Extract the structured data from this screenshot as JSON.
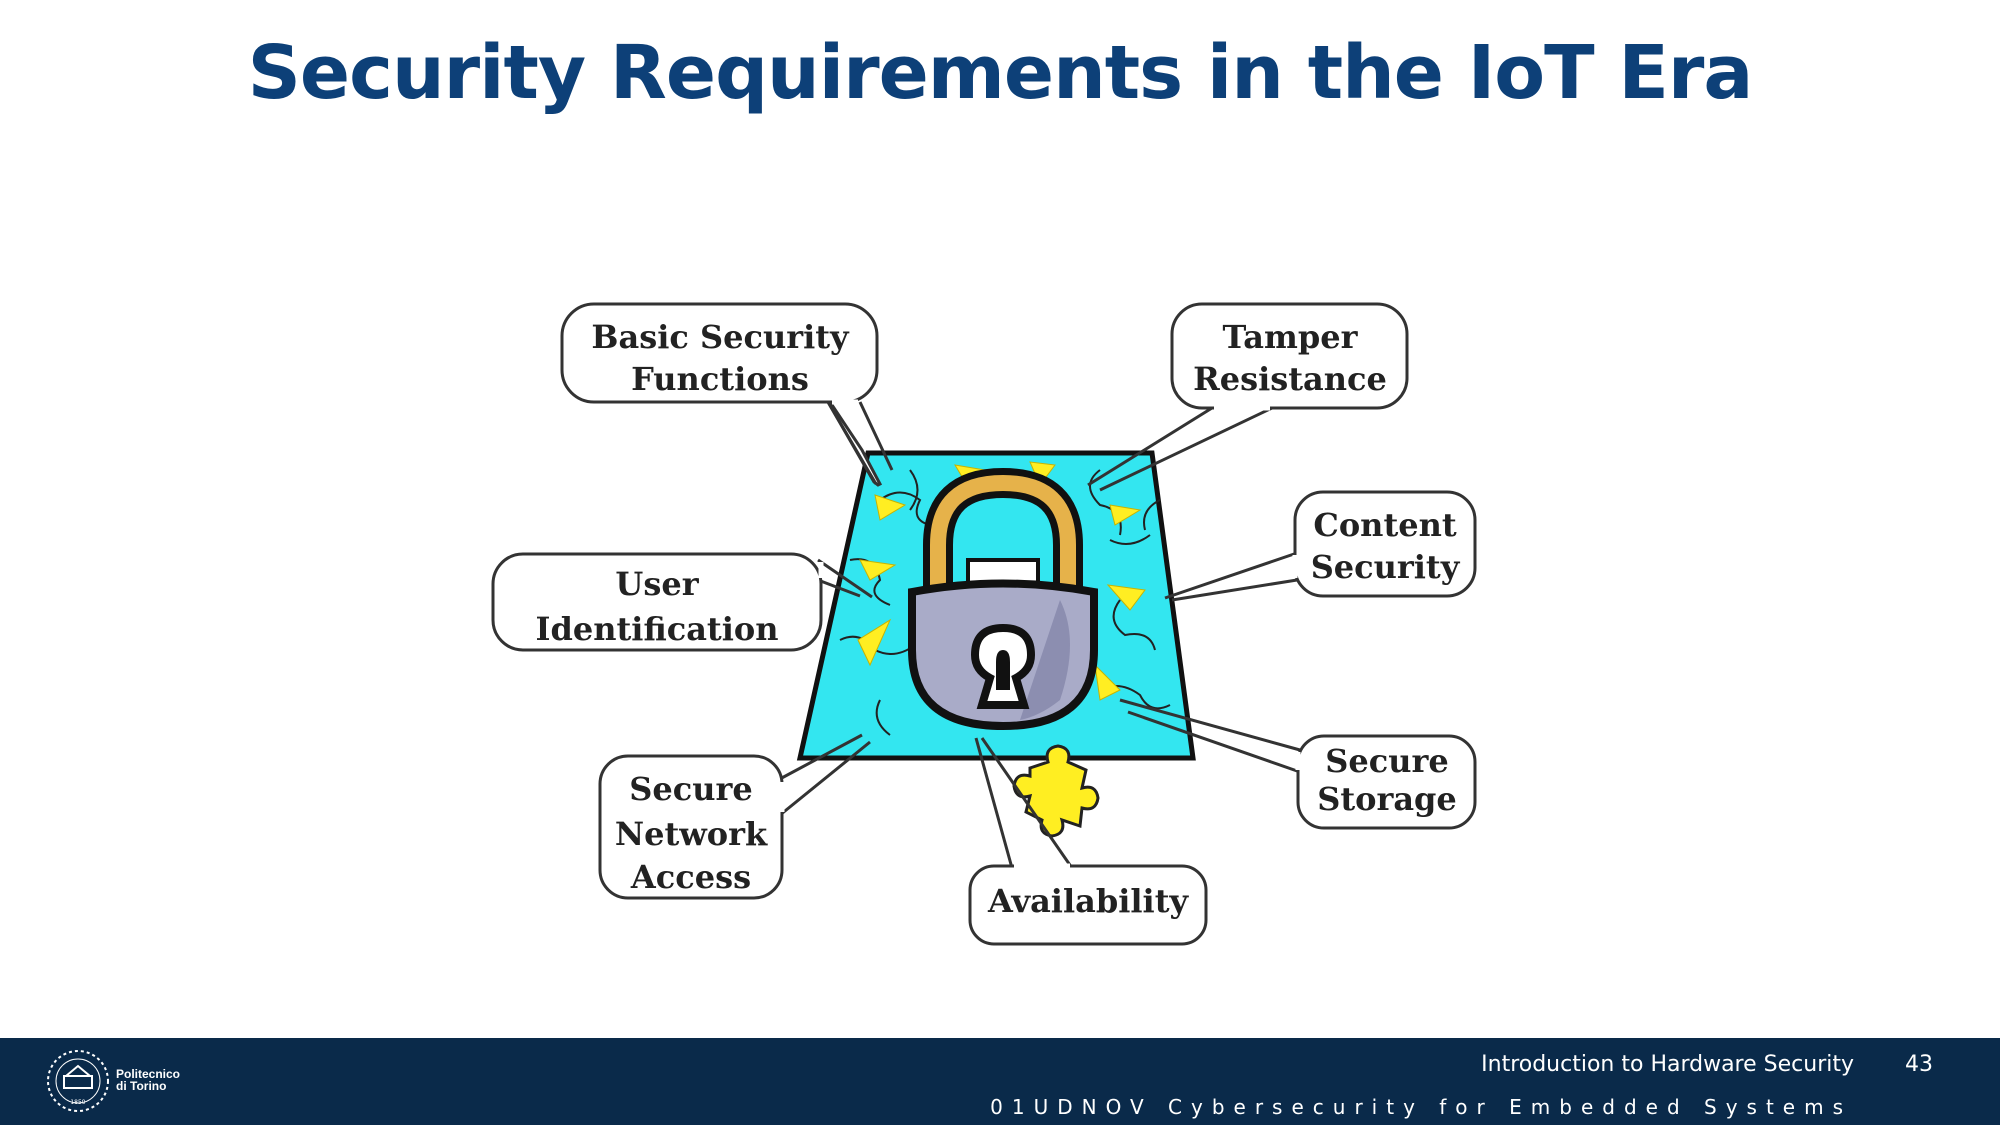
{
  "slide": {
    "title": "Security Requirements in the IoT Era"
  },
  "diagram": {
    "callouts": [
      {
        "id": "basic-security-functions",
        "lines": [
          "Basic Security",
          "Functions"
        ]
      },
      {
        "id": "tamper-resistance",
        "lines": [
          "Tamper",
          "Resistance"
        ]
      },
      {
        "id": "content-security",
        "lines": [
          "Content",
          "Security"
        ]
      },
      {
        "id": "user-identification",
        "lines": [
          "User",
          "Identification"
        ]
      },
      {
        "id": "secure-storage",
        "lines": [
          "Secure",
          "Storage"
        ]
      },
      {
        "id": "secure-network-access",
        "lines": [
          "Secure",
          "Network",
          "Access"
        ]
      },
      {
        "id": "availability",
        "lines": [
          "Availability"
        ]
      }
    ],
    "central_icon": "padlock-on-puzzle-icon"
  },
  "footer": {
    "course_title": "Introduction to Hardware Security",
    "page_number": "43",
    "course_code": "01UDNOV Cybersecurity for Embedded Systems",
    "logo_lines": [
      "Politecnico",
      "di Torino"
    ],
    "logo_year": "1859"
  },
  "colors": {
    "title": "#0d4078",
    "footer_bg": "#0a2a4a",
    "puzzle": "#33e6f0",
    "sparks": "#ffee22",
    "lock_body": "#a9abc8",
    "shackle": "#e6b24a"
  }
}
